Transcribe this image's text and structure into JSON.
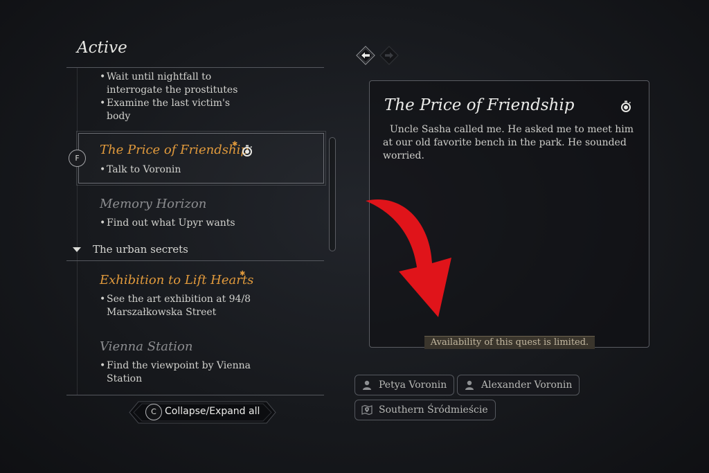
{
  "left_panel": {
    "title": "Active",
    "clipped_objectives": [
      "Wait until nightfall to interrogate the prostitutes",
      "Examine the last victim's body"
    ],
    "quests": [
      {
        "title": "The Price of Friendship",
        "objective": "Talk to Voronin",
        "selected": true,
        "new": true,
        "timed": true,
        "key": "F"
      },
      {
        "title": "Memory Horizon",
        "objective": "Find out what Upyr wants"
      }
    ],
    "category": {
      "label": "The urban secrets",
      "quests": [
        {
          "title": "Exhibition to Lift Hearts",
          "objective": "See the art exhibition at 94/8 Marszałkowska Street",
          "new": true
        },
        {
          "title": "Vienna Station",
          "objective": "Find the viewpoint by Vienna Station"
        }
      ]
    },
    "collapse_button": {
      "key": "C",
      "label": "Collapse/Expand all"
    }
  },
  "detail": {
    "title": "The Price of Friendship",
    "description": "Uncle Sasha called me. He asked me to meet him at our old favorite bench in the park. He sounded worried.",
    "limited_notice": "Availability of this quest is limited."
  },
  "chips": [
    {
      "icon": "person-icon",
      "label": "Petya Voronin"
    },
    {
      "icon": "person-icon",
      "label": "Alexander Voronin"
    },
    {
      "icon": "map-pin-icon",
      "label": "Southern Śródmieście"
    }
  ],
  "colors": {
    "highlight_quest": "#e19a3c",
    "dim_quest": "#8c8d90",
    "annotation_arrow": "#e0141a",
    "badge_bg": "#3a352c"
  }
}
